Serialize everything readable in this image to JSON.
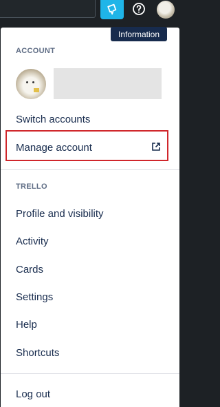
{
  "topbar": {
    "tooltip": "Information",
    "icons": [
      "notification-icon",
      "help-icon",
      "avatar"
    ],
    "accent_color": "#1fb5e8"
  },
  "account_section": {
    "title": "ACCOUNT",
    "switch_label": "Switch accounts",
    "manage_label": "Manage account"
  },
  "trello_section": {
    "title": "TRELLO",
    "items": [
      {
        "label": "Profile and visibility"
      },
      {
        "label": "Activity"
      },
      {
        "label": "Cards"
      },
      {
        "label": "Settings"
      },
      {
        "label": "Help"
      },
      {
        "label": "Shortcuts"
      }
    ]
  },
  "footer": {
    "logout_label": "Log out"
  }
}
